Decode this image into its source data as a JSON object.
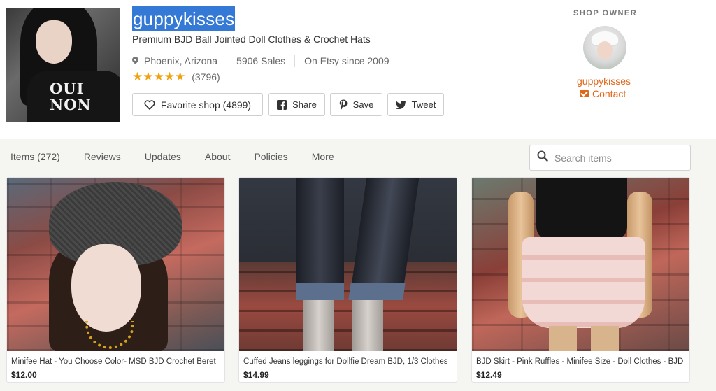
{
  "shop": {
    "name": "guppykisses",
    "tagline": "Premium BJD Ball Jointed Doll Clothes & Crochet Hats",
    "location": "Phoenix, Arizona",
    "sales": "5906 Sales",
    "since": "On Etsy since 2009",
    "stars": "★★★★★",
    "review_count": "(3796)",
    "avatar_text_line1": "OUI",
    "avatar_text_line2": "NON"
  },
  "actions": {
    "favorite": "Favorite shop (4899)",
    "share": "Share",
    "save": "Save",
    "tweet": "Tweet"
  },
  "owner": {
    "heading": "SHOP OWNER",
    "name": "guppykisses",
    "contact": "Contact"
  },
  "tabs": [
    {
      "label": "Items (272)"
    },
    {
      "label": "Reviews"
    },
    {
      "label": "Updates"
    },
    {
      "label": "About"
    },
    {
      "label": "Policies"
    },
    {
      "label": "More"
    }
  ],
  "search": {
    "placeholder": "Search items",
    "value": ""
  },
  "listings": [
    {
      "title": "Minifee Hat - You Choose Color- MSD BJD Crochet Beret",
      "price": "$12.00"
    },
    {
      "title": "Cuffed Jeans leggings for Dollfie Dream BJD, 1/3 Clothes",
      "price": "$14.99"
    },
    {
      "title": "BJD Skirt - Pink Ruffles - Minifee Size - Doll Clothes - BJD",
      "price": "$12.49"
    }
  ],
  "colors": {
    "accent": "#e0661a",
    "star": "#f1a10d",
    "selection": "#3479d6",
    "band": "#f5f5f1"
  }
}
